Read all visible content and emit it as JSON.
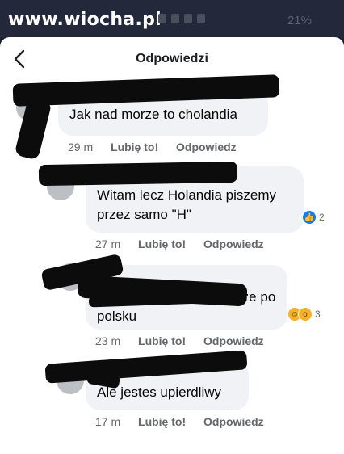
{
  "watermark": "www.wiocha.pl",
  "status_bar": {
    "battery": "21%"
  },
  "header": {
    "title": "Odpowiedzi",
    "back_icon": "chevron-left-icon"
  },
  "comments": [
    {
      "text": "Jak nad morze to cholandia",
      "time": "29 m",
      "like": "Lubię to!",
      "reply": "Odpowiedz"
    },
    {
      "text": "Witam lecz Holandia piszemy przez samo \"H\"",
      "time": "27 m",
      "like": "Lubię to!",
      "reply": "Odpowiedz",
      "reactions": {
        "icons": [
          "like-icon"
        ],
        "count": "2"
      }
    },
    {
      "text": "ja pisze po polsku",
      "time": "23 m",
      "like": "Lubię to!",
      "reply": "Odpowiedz",
      "reactions": {
        "icons": [
          "haha-icon",
          "wow-icon"
        ],
        "count": "3"
      }
    },
    {
      "text": "Ale jestes upierdliwy",
      "time": "17 m",
      "like": "Lubię to!",
      "reply": "Odpowiedz"
    }
  ],
  "colors": {
    "accent_like": "#1877f2",
    "bubble": "#f0f2f5",
    "meta": "#65676b"
  }
}
